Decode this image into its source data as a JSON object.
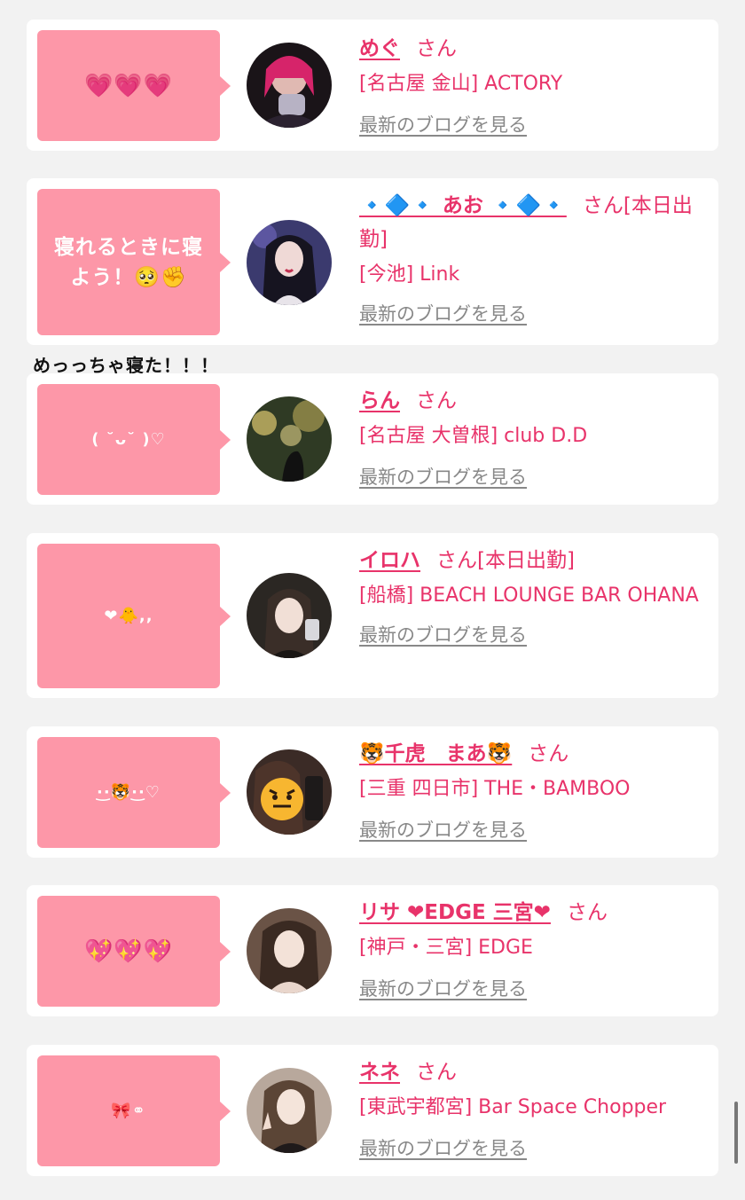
{
  "floating_text": "めっっちゃ寝た！！！",
  "blog_link_label": "最新のブログを見る",
  "honorific": "さん",
  "colors": {
    "bubble": "#fd97a8",
    "accent": "#e8336a",
    "link_gray": "#888888",
    "background": "#f2f2f2"
  },
  "cards": [
    {
      "bubble": "💗💗💗",
      "name": "めぐ",
      "suffix": "さん",
      "shop": "[名古屋 金山] ACTORY"
    },
    {
      "bubble": "寝れるときに寝よう！🥺✊",
      "name": "🔹🔷🔹 あお 🔹🔷🔹",
      "suffix": "さん[本日出勤]",
      "shop": "[今池] Link"
    },
    {
      "bubble": "( ˘ᴗ˘ )♡",
      "name": "らん",
      "suffix": "さん",
      "shop": "[名古屋 大曽根] club D.D"
    },
    {
      "bubble": "❤🐥,,",
      "name": "イロハ",
      "suffix": "さん[本日出勤]",
      "shop": "[船橋] BEACH LOUNGE BAR OHANA"
    },
    {
      "bubble": "·͜·🐯·͜·♡",
      "name": "🐯千虎　まあ🐯",
      "suffix": "さん",
      "shop": "[三重 四日市] THE・BAMBOO"
    },
    {
      "bubble": "💖💖💖",
      "name": "リサ ❤EDGE 三宮❤",
      "suffix": "さん",
      "shop": "[神戸・三宮] EDGE"
    },
    {
      "bubble": "🎀⚭",
      "name": "ネネ",
      "suffix": "さん",
      "shop": "[東武宇都宮] Bar Space Chopper"
    }
  ]
}
